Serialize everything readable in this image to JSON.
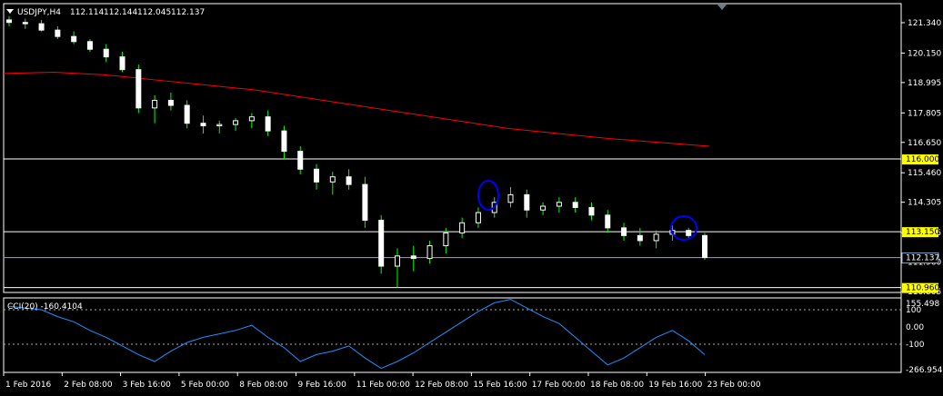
{
  "header": {
    "symbol": "USDJPY,H4",
    "open": "112.114",
    "high": "112.144",
    "low": "112.045",
    "close": "112.137"
  },
  "indicator": {
    "label": "CCI(20) -160.4104"
  },
  "price_axis": {
    "labels": [
      "121.340",
      "120.150",
      "118.995",
      "117.805",
      "116.650",
      "115.460",
      "114.305",
      "113.115",
      "111.960",
      "110.805"
    ],
    "hlines": [
      {
        "value": "116.000",
        "color": "#ffffff"
      },
      {
        "value": "113.150",
        "color": "#ffffff"
      },
      {
        "value": "110.960",
        "color": "#ffffff"
      }
    ],
    "bid": {
      "value": "112.137",
      "color": "#87a8d8"
    }
  },
  "cci_axis": {
    "labels": [
      "155.498",
      "100",
      "0.00",
      "-100",
      "-266.9549"
    ]
  },
  "time_axis": {
    "labels": [
      "1 Feb 2016",
      "2 Feb 08:00",
      "3 Feb 16:00",
      "5 Feb 00:00",
      "8 Feb 08:00",
      "9 Feb 16:00",
      "11 Feb 00:00",
      "12 Feb 08:00",
      "15 Feb 16:00",
      "17 Feb 00:00",
      "18 Feb 08:00",
      "19 Feb 16:00",
      "23 Feb 00:00"
    ]
  },
  "colors": {
    "bg": "#000000",
    "bull": "#ffffff",
    "bear": "#ffffff",
    "wick": "#00ff00",
    "ma": "#ff0000",
    "cci": "#1e90ff",
    "circle": "#0000ff",
    "hline_tag_bg": "#ffff00"
  },
  "chart_data": {
    "type": "candlestick",
    "symbol": "USDJPY",
    "timeframe": "H4",
    "moving_average": [
      119.35,
      119.4,
      119.3,
      119.1,
      118.9,
      118.7,
      118.4,
      118.1,
      117.8,
      117.5,
      117.2,
      117.0,
      116.8,
      116.65,
      116.5
    ],
    "candles": [
      [
        121.45,
        121.6,
        121.2,
        121.35
      ],
      [
        121.35,
        121.5,
        121.1,
        121.3
      ],
      [
        121.3,
        121.45,
        121.0,
        121.05
      ],
      [
        121.05,
        121.2,
        120.7,
        120.8
      ],
      [
        120.8,
        121.0,
        120.5,
        120.6
      ],
      [
        120.6,
        120.7,
        120.2,
        120.3
      ],
      [
        120.3,
        120.5,
        119.8,
        120.0
      ],
      [
        120.0,
        120.2,
        119.4,
        119.5
      ],
      [
        119.5,
        119.7,
        117.8,
        118.0
      ],
      [
        118.0,
        118.5,
        117.4,
        118.3
      ],
      [
        118.3,
        118.6,
        117.9,
        118.1
      ],
      [
        118.1,
        118.3,
        117.2,
        117.4
      ],
      [
        117.4,
        117.7,
        117.0,
        117.3
      ],
      [
        117.3,
        117.5,
        117.0,
        117.35
      ],
      [
        117.35,
        117.6,
        117.1,
        117.5
      ],
      [
        117.5,
        117.8,
        117.2,
        117.65
      ],
      [
        117.65,
        117.9,
        116.9,
        117.1
      ],
      [
        117.1,
        117.3,
        116.0,
        116.3
      ],
      [
        116.3,
        116.5,
        115.4,
        115.6
      ],
      [
        115.6,
        115.8,
        114.8,
        115.1
      ],
      [
        115.1,
        115.5,
        114.6,
        115.3
      ],
      [
        115.3,
        115.6,
        114.8,
        115.0
      ],
      [
        115.0,
        115.3,
        113.3,
        113.6
      ],
      [
        113.6,
        113.8,
        111.5,
        111.8
      ],
      [
        111.8,
        112.5,
        110.96,
        112.2
      ],
      [
        112.2,
        112.6,
        111.6,
        112.1
      ],
      [
        112.1,
        112.8,
        111.9,
        112.6
      ],
      [
        112.6,
        113.3,
        112.3,
        113.1
      ],
      [
        113.1,
        113.7,
        112.9,
        113.5
      ],
      [
        113.5,
        114.1,
        113.3,
        113.9
      ],
      [
        113.9,
        114.5,
        113.7,
        114.3
      ],
      [
        114.3,
        114.9,
        114.1,
        114.6
      ],
      [
        114.6,
        114.8,
        113.7,
        114.0
      ],
      [
        114.0,
        114.3,
        113.8,
        114.15
      ],
      [
        114.15,
        114.5,
        113.9,
        114.3
      ],
      [
        114.3,
        114.5,
        113.9,
        114.1
      ],
      [
        114.1,
        114.3,
        113.6,
        113.8
      ],
      [
        113.8,
        114.0,
        113.1,
        113.3
      ],
      [
        113.3,
        113.5,
        112.8,
        113.0
      ],
      [
        113.0,
        113.3,
        112.6,
        112.8
      ],
      [
        112.8,
        113.2,
        112.5,
        113.05
      ],
      [
        113.05,
        113.4,
        112.8,
        113.2
      ],
      [
        113.2,
        113.3,
        112.9,
        113.0
      ],
      [
        113.0,
        113.1,
        112.05,
        112.137
      ]
    ],
    "cci": [
      120,
      110,
      100,
      60,
      30,
      -20,
      -60,
      -110,
      -160,
      -200,
      -140,
      -90,
      -60,
      -40,
      -20,
      10,
      -60,
      -120,
      -200,
      -160,
      -140,
      -110,
      -180,
      -240,
      -200,
      -150,
      -90,
      -30,
      30,
      90,
      140,
      160,
      110,
      60,
      20,
      -60,
      -140,
      -220,
      -180,
      -120,
      -60,
      -20,
      -80,
      -160.41
    ]
  }
}
